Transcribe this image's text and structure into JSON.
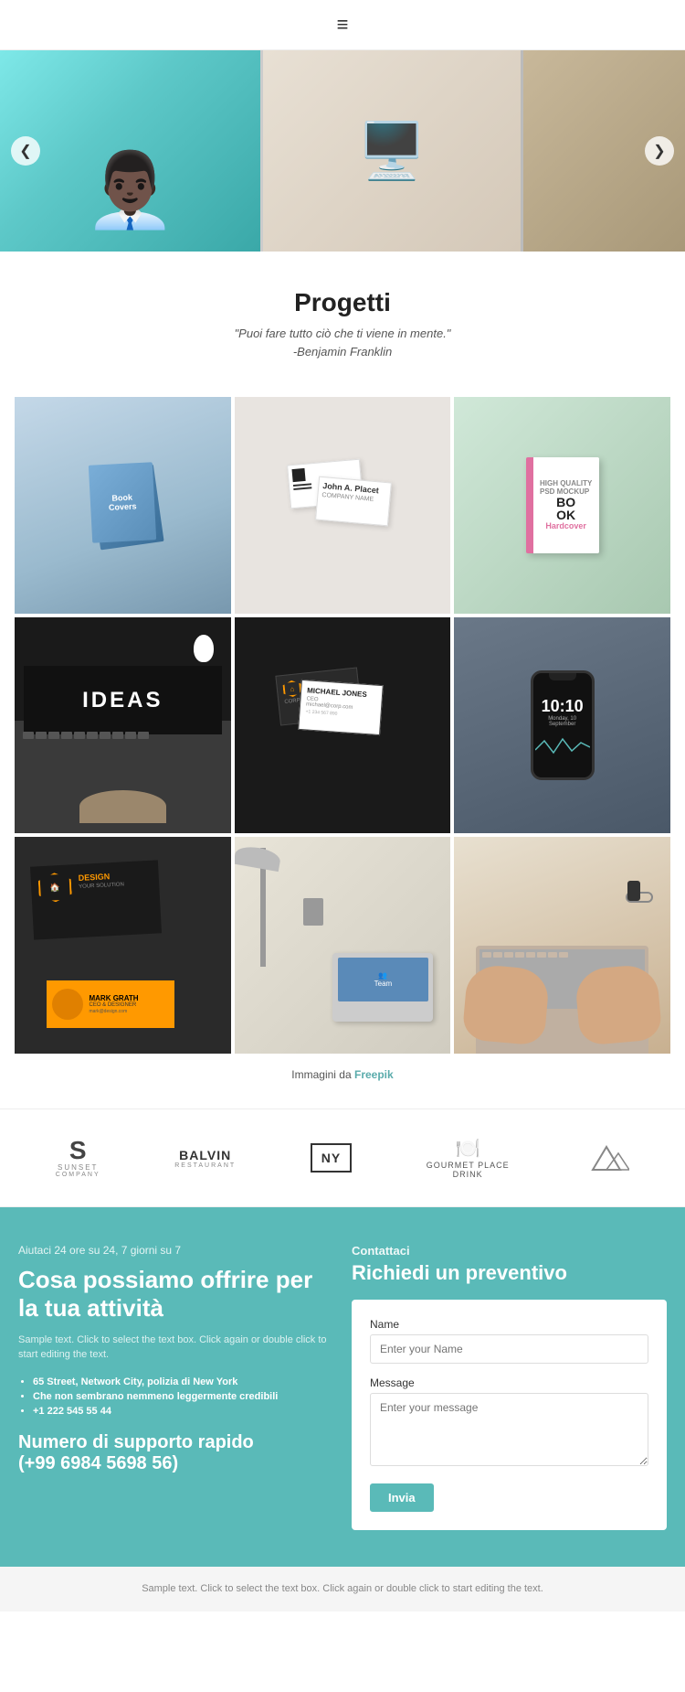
{
  "nav": {
    "hamburger": "≡"
  },
  "carousel": {
    "prev_label": "❮",
    "next_label": "❯"
  },
  "progetti": {
    "title": "Progetti",
    "quote_line1": "\"Puoi fare tutto ciò che ti viene in mente.\"",
    "quote_line2": "-Benjamin Franklin"
  },
  "grid": {
    "items": [
      {
        "id": "book-covers",
        "alt": "Book covers mockup"
      },
      {
        "id": "business-cards",
        "alt": "Business cards mockup"
      },
      {
        "id": "book-hardcover",
        "alt": "Book hardcover mockup"
      },
      {
        "id": "ideas-laptop",
        "alt": "IDEAS laptop screen"
      },
      {
        "id": "dark-business-cards",
        "alt": "Dark business cards"
      },
      {
        "id": "phone-mockup",
        "alt": "Phone mockup 10:10"
      },
      {
        "id": "design-card",
        "alt": "Design business card"
      },
      {
        "id": "laptop-lamp",
        "alt": "Laptop and lamp"
      },
      {
        "id": "hands-keyboard",
        "alt": "Hands on keyboard"
      }
    ],
    "phone_time": "10:10",
    "phone_date": "Monday, 10 September",
    "ideas_text": "IDEAS",
    "immagini_text": "Immagini da ",
    "freepik_text": "Freepik"
  },
  "logos": [
    {
      "id": "sunset",
      "letter": "S",
      "name": "SUNSET",
      "sub": "COMPANY"
    },
    {
      "id": "balvin",
      "main": "BALVIN",
      "sub": "RESTAURANT"
    },
    {
      "id": "ny",
      "text": "NY"
    },
    {
      "id": "gourmet",
      "icon": "🍽️",
      "line1": "GOURMET PLACE",
      "line2": "DRINK"
    },
    {
      "id": "mountain",
      "icon": "⛰️"
    }
  ],
  "contact": {
    "availability": "Aiutaci 24 ore su 24, 7 giorni su 7",
    "heading": "Cosa possiamo offrire per la tua attività",
    "sample_text": "Sample text. Click to select the text box. Click again or double click to start editing the text.",
    "list_items": [
      "65 Street, Network City, polizia di New York",
      "Che non sembrano nemmeno leggermente credibili",
      "+1 222 545 55 44"
    ],
    "support_label": "Numero di supporto rapido",
    "phone": "(+99 6984 5698 56)",
    "right_label": "Contattaci",
    "right_heading": "Richiedi un preventivo",
    "form": {
      "name_label": "Name",
      "name_placeholder": "Enter your Name",
      "message_label": "Message",
      "message_placeholder": "Enter your message",
      "submit_label": "Invia"
    }
  },
  "footer": {
    "text": "Sample text. Click to select the text box. Click again or double click to start editing the text."
  }
}
